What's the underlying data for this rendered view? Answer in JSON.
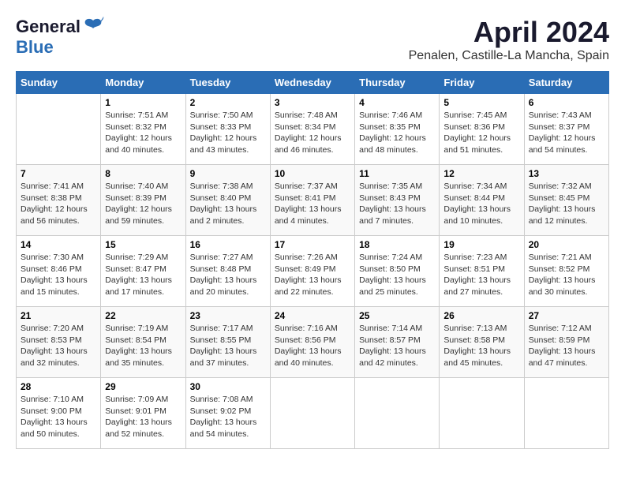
{
  "header": {
    "logo_line1": "General",
    "logo_line2": "Blue",
    "month": "April 2024",
    "location": "Penalen, Castille-La Mancha, Spain"
  },
  "columns": [
    "Sunday",
    "Monday",
    "Tuesday",
    "Wednesday",
    "Thursday",
    "Friday",
    "Saturday"
  ],
  "weeks": [
    [
      {
        "day": "",
        "info": ""
      },
      {
        "day": "1",
        "info": "Sunrise: 7:51 AM\nSunset: 8:32 PM\nDaylight: 12 hours\nand 40 minutes."
      },
      {
        "day": "2",
        "info": "Sunrise: 7:50 AM\nSunset: 8:33 PM\nDaylight: 12 hours\nand 43 minutes."
      },
      {
        "day": "3",
        "info": "Sunrise: 7:48 AM\nSunset: 8:34 PM\nDaylight: 12 hours\nand 46 minutes."
      },
      {
        "day": "4",
        "info": "Sunrise: 7:46 AM\nSunset: 8:35 PM\nDaylight: 12 hours\nand 48 minutes."
      },
      {
        "day": "5",
        "info": "Sunrise: 7:45 AM\nSunset: 8:36 PM\nDaylight: 12 hours\nand 51 minutes."
      },
      {
        "day": "6",
        "info": "Sunrise: 7:43 AM\nSunset: 8:37 PM\nDaylight: 12 hours\nand 54 minutes."
      }
    ],
    [
      {
        "day": "7",
        "info": "Sunrise: 7:41 AM\nSunset: 8:38 PM\nDaylight: 12 hours\nand 56 minutes."
      },
      {
        "day": "8",
        "info": "Sunrise: 7:40 AM\nSunset: 8:39 PM\nDaylight: 12 hours\nand 59 minutes."
      },
      {
        "day": "9",
        "info": "Sunrise: 7:38 AM\nSunset: 8:40 PM\nDaylight: 13 hours\nand 2 minutes."
      },
      {
        "day": "10",
        "info": "Sunrise: 7:37 AM\nSunset: 8:41 PM\nDaylight: 13 hours\nand 4 minutes."
      },
      {
        "day": "11",
        "info": "Sunrise: 7:35 AM\nSunset: 8:43 PM\nDaylight: 13 hours\nand 7 minutes."
      },
      {
        "day": "12",
        "info": "Sunrise: 7:34 AM\nSunset: 8:44 PM\nDaylight: 13 hours\nand 10 minutes."
      },
      {
        "day": "13",
        "info": "Sunrise: 7:32 AM\nSunset: 8:45 PM\nDaylight: 13 hours\nand 12 minutes."
      }
    ],
    [
      {
        "day": "14",
        "info": "Sunrise: 7:30 AM\nSunset: 8:46 PM\nDaylight: 13 hours\nand 15 minutes."
      },
      {
        "day": "15",
        "info": "Sunrise: 7:29 AM\nSunset: 8:47 PM\nDaylight: 13 hours\nand 17 minutes."
      },
      {
        "day": "16",
        "info": "Sunrise: 7:27 AM\nSunset: 8:48 PM\nDaylight: 13 hours\nand 20 minutes."
      },
      {
        "day": "17",
        "info": "Sunrise: 7:26 AM\nSunset: 8:49 PM\nDaylight: 13 hours\nand 22 minutes."
      },
      {
        "day": "18",
        "info": "Sunrise: 7:24 AM\nSunset: 8:50 PM\nDaylight: 13 hours\nand 25 minutes."
      },
      {
        "day": "19",
        "info": "Sunrise: 7:23 AM\nSunset: 8:51 PM\nDaylight: 13 hours\nand 27 minutes."
      },
      {
        "day": "20",
        "info": "Sunrise: 7:21 AM\nSunset: 8:52 PM\nDaylight: 13 hours\nand 30 minutes."
      }
    ],
    [
      {
        "day": "21",
        "info": "Sunrise: 7:20 AM\nSunset: 8:53 PM\nDaylight: 13 hours\nand 32 minutes."
      },
      {
        "day": "22",
        "info": "Sunrise: 7:19 AM\nSunset: 8:54 PM\nDaylight: 13 hours\nand 35 minutes."
      },
      {
        "day": "23",
        "info": "Sunrise: 7:17 AM\nSunset: 8:55 PM\nDaylight: 13 hours\nand 37 minutes."
      },
      {
        "day": "24",
        "info": "Sunrise: 7:16 AM\nSunset: 8:56 PM\nDaylight: 13 hours\nand 40 minutes."
      },
      {
        "day": "25",
        "info": "Sunrise: 7:14 AM\nSunset: 8:57 PM\nDaylight: 13 hours\nand 42 minutes."
      },
      {
        "day": "26",
        "info": "Sunrise: 7:13 AM\nSunset: 8:58 PM\nDaylight: 13 hours\nand 45 minutes."
      },
      {
        "day": "27",
        "info": "Sunrise: 7:12 AM\nSunset: 8:59 PM\nDaylight: 13 hours\nand 47 minutes."
      }
    ],
    [
      {
        "day": "28",
        "info": "Sunrise: 7:10 AM\nSunset: 9:00 PM\nDaylight: 13 hours\nand 50 minutes."
      },
      {
        "day": "29",
        "info": "Sunrise: 7:09 AM\nSunset: 9:01 PM\nDaylight: 13 hours\nand 52 minutes."
      },
      {
        "day": "30",
        "info": "Sunrise: 7:08 AM\nSunset: 9:02 PM\nDaylight: 13 hours\nand 54 minutes."
      },
      {
        "day": "",
        "info": ""
      },
      {
        "day": "",
        "info": ""
      },
      {
        "day": "",
        "info": ""
      },
      {
        "day": "",
        "info": ""
      }
    ]
  ]
}
